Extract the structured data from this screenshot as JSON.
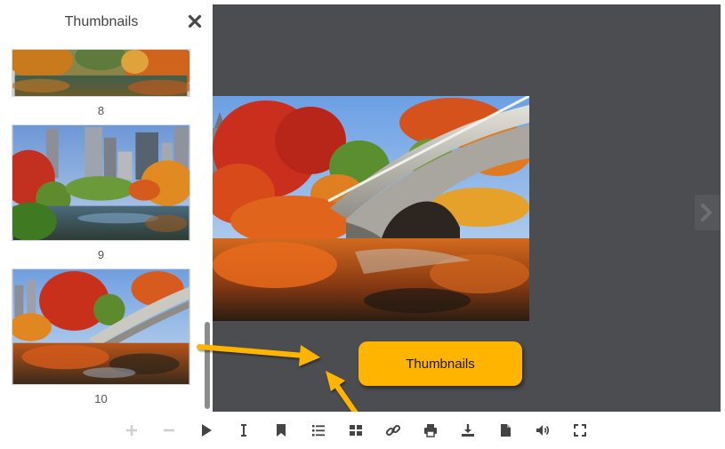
{
  "sidebar": {
    "title": "Thumbnails",
    "close_icon": "close-icon",
    "thumbnails": [
      {
        "number": "8"
      },
      {
        "number": "9"
      },
      {
        "number": "10"
      }
    ]
  },
  "viewer": {
    "next_icon": "chevron-right-icon"
  },
  "callout": {
    "label": "Thumbnails",
    "color": "#ffb400"
  },
  "toolbar": {
    "items": [
      {
        "icon": "zoom-in-icon",
        "enabled": false
      },
      {
        "icon": "zoom-out-icon",
        "enabled": false
      },
      {
        "icon": "play-icon",
        "enabled": true
      },
      {
        "icon": "text-select-icon",
        "enabled": true
      },
      {
        "icon": "bookmark-icon",
        "enabled": true
      },
      {
        "icon": "outline-list-icon",
        "enabled": true
      },
      {
        "icon": "thumbnails-grid-icon",
        "enabled": true
      },
      {
        "icon": "link-icon",
        "enabled": true
      },
      {
        "icon": "print-icon",
        "enabled": true
      },
      {
        "icon": "download-icon",
        "enabled": true
      },
      {
        "icon": "document-icon",
        "enabled": true
      },
      {
        "icon": "sound-icon",
        "enabled": true
      },
      {
        "icon": "fullscreen-icon",
        "enabled": true
      }
    ]
  },
  "colors": {
    "viewer_background": "#4c4d50",
    "icon_active": "#444444",
    "icon_disabled": "#cfcfcf",
    "arrow": "#ffb400"
  }
}
